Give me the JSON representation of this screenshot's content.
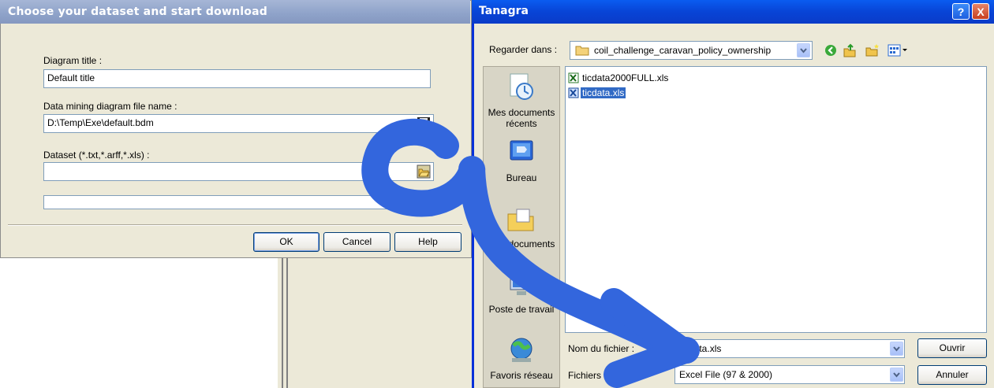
{
  "left_dialog": {
    "title": "Choose your dataset and start download",
    "diagram_title_label": "Diagram title :",
    "diagram_title_value": "Default title",
    "file_name_label": "Data mining diagram file name :",
    "file_name_value": "D:\\Temp\\Exe\\default.bdm",
    "dataset_label": "Dataset (*.txt,*.arff,*.xls) :",
    "dataset_value": "",
    "buttons": {
      "ok": "OK",
      "cancel": "Cancel",
      "help": "Help"
    }
  },
  "open_dialog": {
    "title": "Tanagra",
    "help_glyph": "?",
    "close_glyph": "X",
    "look_in_label": "Regarder dans :",
    "look_in_value": "coil_challenge_caravan_policy_ownership",
    "places": [
      {
        "label_line1": "Mes documents",
        "label_line2": "récents",
        "icon": "recent-documents-icon"
      },
      {
        "label_line1": "Bureau",
        "label_line2": "",
        "icon": "desktop-icon"
      },
      {
        "label_line1": "Mes documents",
        "label_line2": "",
        "icon": "my-documents-icon"
      },
      {
        "label_line1": "Poste de travail",
        "label_line2": "",
        "icon": "my-computer-icon"
      },
      {
        "label_line1": "Favoris réseau",
        "label_line2": "",
        "icon": "network-places-icon"
      }
    ],
    "files": [
      {
        "name": "ticdata2000FULL.xls",
        "selected": false
      },
      {
        "name": "ticdata.xls",
        "selected": true
      }
    ],
    "file_name_label": "Nom du fichier :",
    "file_name_value": "ticdata.xls",
    "file_type_label": "Fichiers de type :",
    "file_type_value": "Excel File (97 & 2000)",
    "buttons": {
      "open": "Ouvrir",
      "cancel": "Annuler"
    }
  },
  "colors": {
    "annotation_arrow": "#3366dd",
    "selection": "#316ac5",
    "xp_title_blue": "#0a5cf0"
  }
}
